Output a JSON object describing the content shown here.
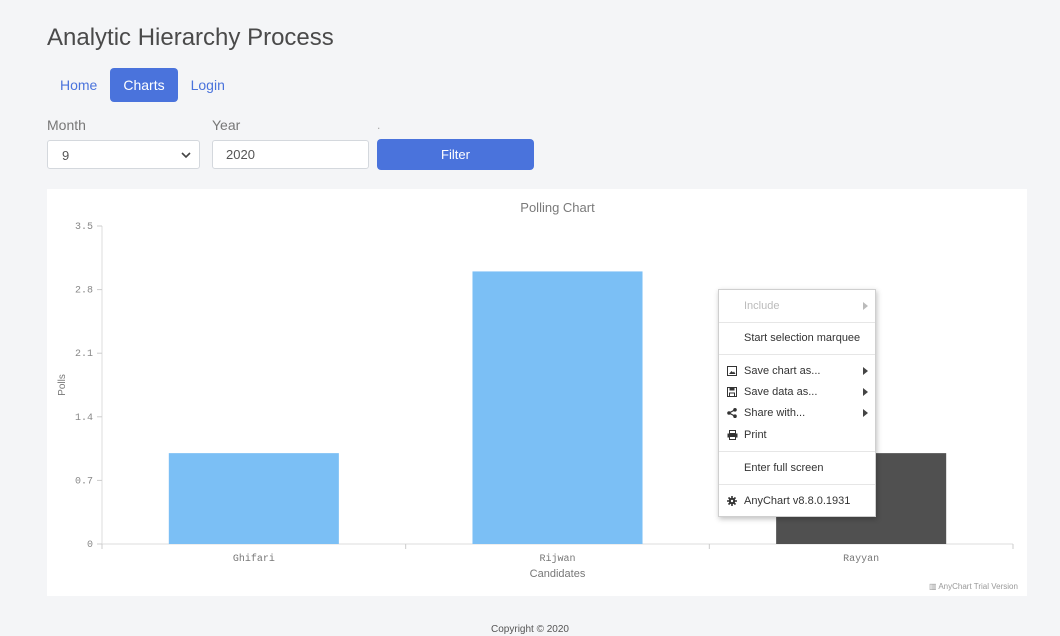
{
  "app": {
    "title": "Analytic Hierarchy Process"
  },
  "nav": {
    "items": [
      {
        "label": "Home"
      },
      {
        "label": "Charts"
      },
      {
        "label": "Login"
      }
    ]
  },
  "filters": {
    "month_label": "Month",
    "month_value": "9",
    "year_label": "Year",
    "year_value": "2020",
    "dot": ".",
    "filter_label": "Filter"
  },
  "chart_data": {
    "type": "bar",
    "title": "Polling Chart",
    "xlabel": "Candidates",
    "ylabel": "Polls",
    "categories": [
      "Ghifari",
      "Rijwan",
      "Rayyan"
    ],
    "values": [
      1,
      3,
      1
    ],
    "ylim": [
      0,
      3.5
    ],
    "yticks": [
      "0",
      "0.7",
      "1.4",
      "2.1",
      "2.8",
      "3.5"
    ],
    "yticks_values": [
      0,
      0.7,
      1.4,
      2.1,
      2.8,
      3.5
    ],
    "bar_colors": [
      "#7bbff5",
      "#7bbff5",
      "#505050"
    ],
    "grid": false,
    "legend": "none"
  },
  "context_menu": {
    "include": "Include",
    "marquee": "Start selection marquee",
    "save_chart": "Save chart as...",
    "save_data": "Save data as...",
    "share": "Share with...",
    "print": "Print",
    "fullscreen": "Enter full screen",
    "version": "AnyChart v8.8.0.1931"
  },
  "trial_text": "AnyChart Trial Version",
  "footer": {
    "copyright": "Copyright © 2020"
  }
}
